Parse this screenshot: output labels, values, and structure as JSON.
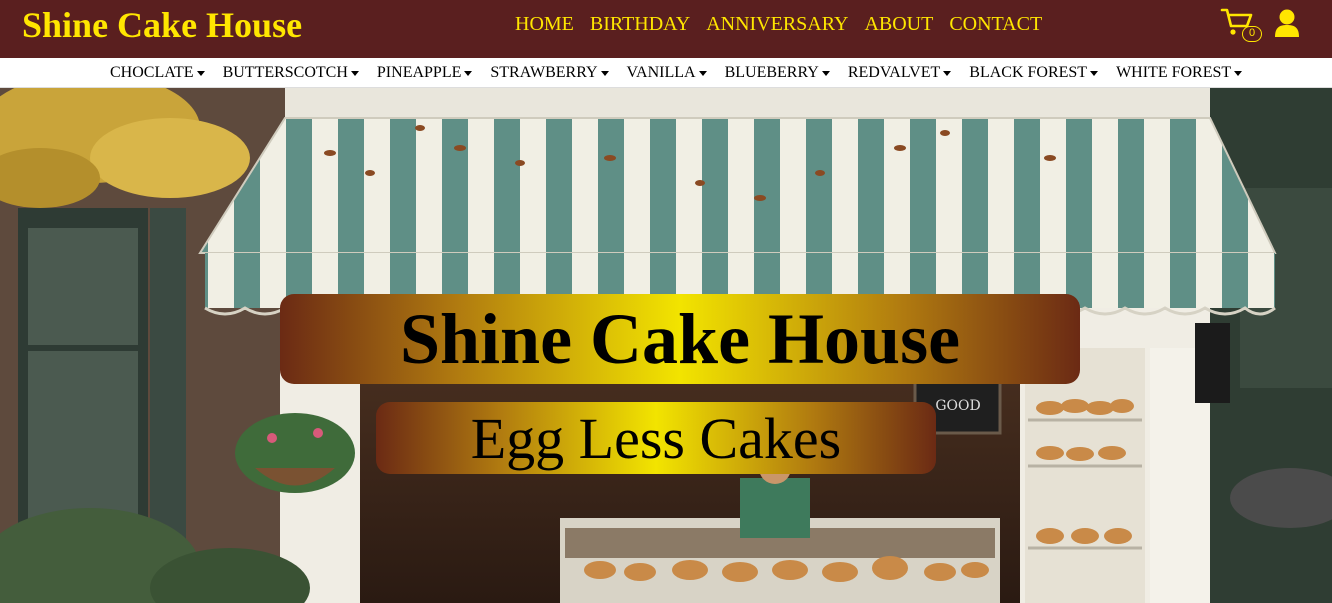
{
  "header": {
    "brand": "Shine Cake House",
    "nav": [
      "HOME",
      "BIRTHDAY",
      "ANNIVERSARY",
      "ABOUT",
      "CONTACT"
    ],
    "cart_icon": "cart-icon",
    "cart_count": "0",
    "user_icon": "user-icon"
  },
  "flavors": [
    "CHOCLATE",
    "BUTTERSCOTCH",
    "PINEAPPLE",
    "STRAWBERRY",
    "VANILLA",
    "BLUEBERRY",
    "REDVALVET",
    "BLACK FOREST",
    "WHITE FOREST"
  ],
  "hero": {
    "title": "Shine Cake House",
    "subtitle": "Egg Less Cakes",
    "sign_text": "GOOD"
  },
  "colors": {
    "header_bg": "#5a1f1f",
    "accent_yellow": "#ffe600",
    "awning_green": "#5f8f86",
    "awning_white": "#f1efe4"
  }
}
